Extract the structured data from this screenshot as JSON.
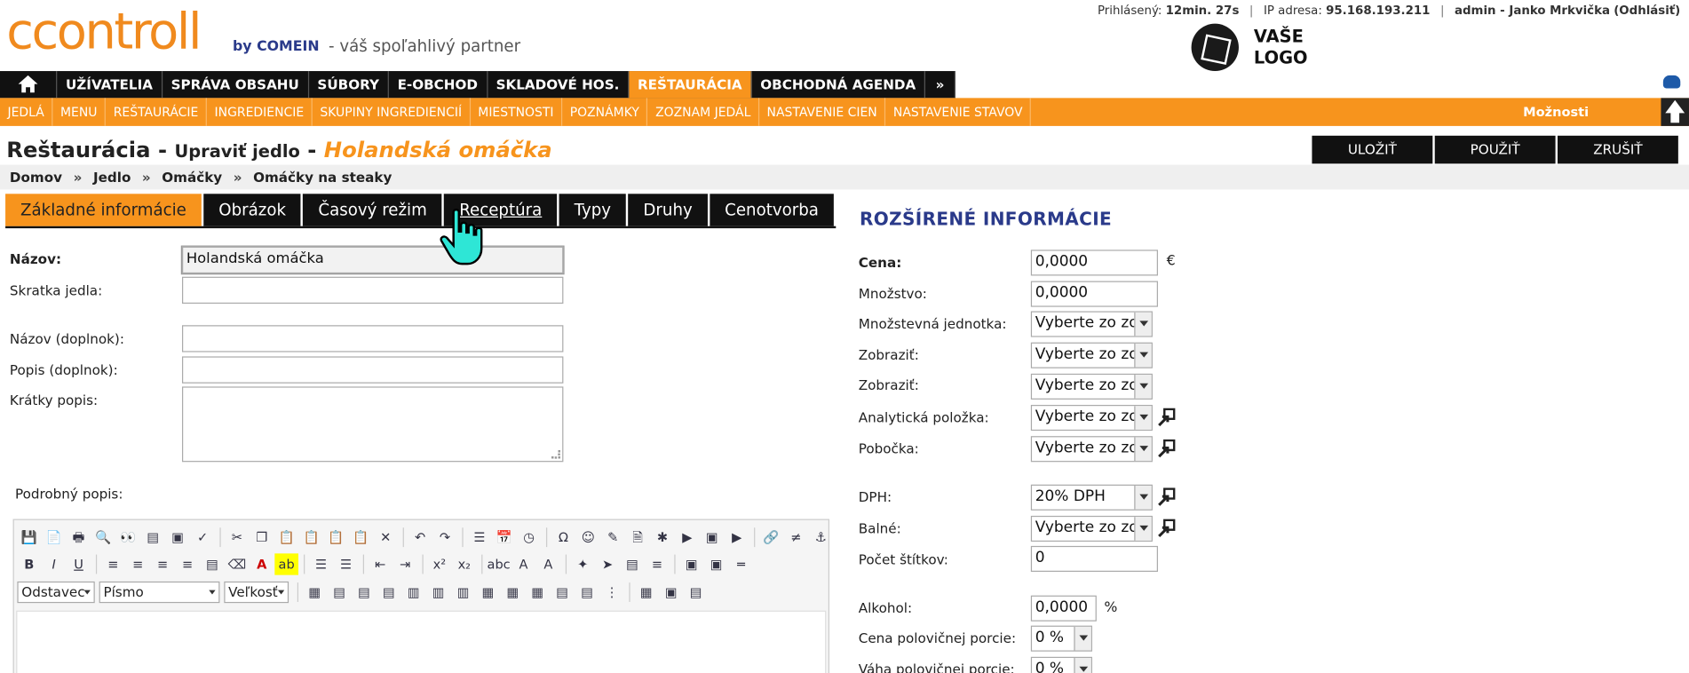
{
  "header": {
    "logo": "ccontroll",
    "logo_by": "by COMEIN",
    "tagline": "- váš spoľahlivý partner",
    "logged_label": "Prihlásený:",
    "logged_time": "12min. 27s",
    "ip_label": "IP adresa:",
    "ip_value": "95.168.193.211",
    "user": "admin - Janko Mrkvička",
    "logout": "(Odhlásiť)",
    "vase_logo": "VAŠE LOGO"
  },
  "nav": {
    "items": [
      "UŽÍVATELIA",
      "SPRÁVA OBSAHU",
      "SÚBORY",
      "E-OBCHOD",
      "SKLADOVÉ HOS.",
      "REŠTAURÁCIA",
      "OBCHODNÁ AGENDA"
    ],
    "more": "»",
    "active": "REŠTAURÁCIA"
  },
  "subnav": {
    "items": [
      "JEDLÁ",
      "MENU",
      "REŠTAURÁCIE",
      "INGREDIENCIE",
      "SKUPINY INGREDIENCIÍ",
      "MIESTNOSTI",
      "POZNÁMKY",
      "ZOZNAM JEDÁL",
      "NASTAVENIE CIEN",
      "NASTAVENIE STAVOV"
    ],
    "options": "Možnosti"
  },
  "title": {
    "section": "Reštaurácia",
    "dash1": " - ",
    "action": "Upraviť jedlo",
    "dash2": " - ",
    "item": "Holandská omáčka"
  },
  "buttons": {
    "save": "ULOŽIŤ",
    "apply": "POUŽIŤ",
    "cancel": "ZRUŠIŤ"
  },
  "breadcrumb": [
    "Domov",
    "Jedlo",
    "Omáčky",
    "Omáčky na steaky"
  ],
  "breadcrumb_sep": "»",
  "tabs": [
    "Základné informácie",
    "Obrázok",
    "Časový režim",
    "Receptúra",
    "Typy",
    "Druhy",
    "Cenotvorba"
  ],
  "form": {
    "name_label": "Názov:",
    "name_value": "Holandská omáčka",
    "short_label": "Skratka jedla:",
    "name_extra_label": "Názov (doplnok):",
    "desc_extra_label": "Popis (doplnok):",
    "short_desc_label": "Krátky popis:",
    "detail_label": "Podrobný popis:"
  },
  "editor": {
    "paragraph": "Odstavec",
    "font": "Písmo",
    "size": "Veľkosť"
  },
  "right": {
    "title": "ROZŠÍRENÉ INFORMÁCIE",
    "price_label": "Cena:",
    "price_value": "0,0000",
    "price_unit": "€",
    "qty_label": "Množstvo:",
    "qty_value": "0,0000",
    "unit_label": "Množstevná jednotka:",
    "unit_value": "Vyberte zo zoz",
    "show1_label": "Zobraziť:",
    "show1_value": "Vyberte zo zoz",
    "show2_label": "Zobraziť:",
    "show2_value": "Vyberte zo zoz",
    "analytic_label": "Analytická položka:",
    "analytic_value": "Vyberte zo zoz",
    "branch_label": "Pobočka:",
    "branch_value": "Vyberte zo zoz",
    "vat_label": "DPH:",
    "vat_value": "20% DPH",
    "packing_label": "Balné:",
    "packing_value": "Vyberte zo zoz",
    "labels_label": "Počet štítkov:",
    "labels_value": "0",
    "alcohol_label": "Alkohol:",
    "alcohol_value": "0,0000",
    "alcohol_unit": "%",
    "half_price_label": "Cena polovičnej porcie:",
    "half_price_value": "0 %",
    "half_weight_label": "Váha polovičnej porcie:",
    "half_weight_value": "0 %"
  },
  "colors": {
    "accent": "#f7941d",
    "dark": "#111111",
    "title_blue": "#2a3a8a"
  }
}
